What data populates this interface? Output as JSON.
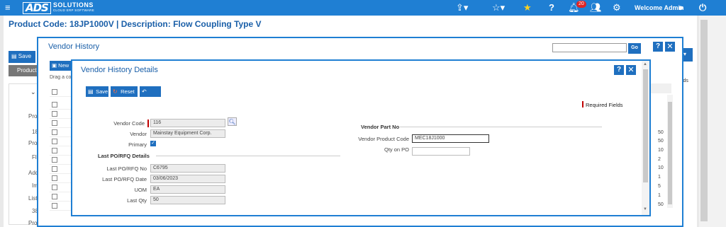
{
  "topbar": {
    "logo_main": "ADS",
    "logo_side_1": "SOLUTIONS",
    "logo_side_2": "CLOUD ERP SOFTWARE",
    "notifications_count": "20",
    "welcome": "Welcome Admin",
    "brand_color": "#1f7fd3"
  },
  "page": {
    "title": "Product Code:  18JP1000V | Description: Flow Coupling Type V",
    "save_label": "Save",
    "product_tab": "Product",
    "right_label": "elds",
    "left_fragments": [
      "Pro",
      "18",
      "Pro",
      "Flo",
      "Add",
      "Im",
      "List",
      "38",
      "Pro"
    ]
  },
  "vendor_history": {
    "title": "Vendor History",
    "search_placeholder": "",
    "go_label": "Go",
    "new_label": "New",
    "drag_text": "Drag a col",
    "qty_column": [
      "50",
      "50",
      "10",
      "2",
      "10",
      "1",
      "5",
      "1",
      "50"
    ]
  },
  "details": {
    "title": "Vendor History Details",
    "save_label": "Save",
    "reset_label": "Reset",
    "back_label": "Back",
    "required_fields": "Required Fields",
    "vendor_code_label": "Vendor Code",
    "vendor_code": "116",
    "vendor_label": "Vendor",
    "vendor": "Mainstay Equipment Corp.",
    "primary_label": "Primary",
    "last_po_section": "Last PO/RFQ Details",
    "last_po_no_label": "Last PO/RFQ No",
    "last_po_no": "C6795",
    "last_po_date_label": "Last PO/RFQ Date",
    "last_po_date": "03/06/2023",
    "uom_label": "UOM",
    "uom": "EA",
    "last_qty_label": "Last Qty",
    "last_qty": "50",
    "vendor_part_section": "Vendor Part No",
    "vendor_product_code_label": "Vendor Product Code",
    "vendor_product_code": "MEC18J1000",
    "qty_on_po_label": "Qty on PO",
    "qty_on_po": ""
  }
}
